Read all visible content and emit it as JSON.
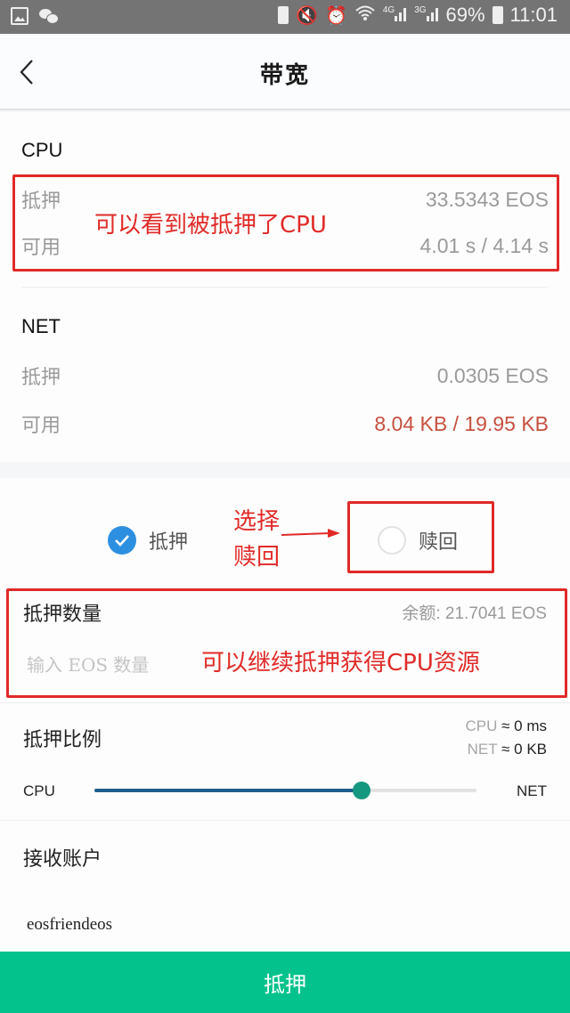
{
  "status_bar": {
    "left_icons": [
      "gallery-icon",
      "wechat-icon"
    ],
    "right_icons": [
      "battery-saver-icon",
      "mute-icon",
      "alarm-icon",
      "wifi-icon",
      "signal-4g-icon",
      "signal-3g-icon"
    ],
    "network_4g": "4G",
    "network_3g": "3G",
    "battery_percent": "69%",
    "time": "11:01"
  },
  "header": {
    "back_icon": "chevron-left-icon",
    "title": "带宽"
  },
  "cpu": {
    "title": "CPU",
    "staked_label": "抵押",
    "staked_value": "33.5343 EOS",
    "available_label": "可用",
    "available_value": "4.01 s / 4.14 s"
  },
  "net": {
    "title": "NET",
    "staked_label": "抵押",
    "staked_value": "0.0305 EOS",
    "available_label": "可用",
    "available_value": "8.04 KB / 19.95 KB",
    "available_color": "#c6503f"
  },
  "mode": {
    "options": [
      {
        "label": "抵押",
        "checked": true
      },
      {
        "label": "赎回",
        "checked": false
      }
    ]
  },
  "stake_amount": {
    "label": "抵押数量",
    "balance": "余额: 21.7041 EOS",
    "placeholder": "输入 EOS 数量",
    "value": ""
  },
  "ratio": {
    "label": "抵押比例",
    "cpu_key": "CPU",
    "cpu_est": " ≈ 0 ms",
    "net_key": "NET",
    "net_est": " ≈ 0 KB",
    "left_label": "CPU",
    "right_label": "NET",
    "slider_fraction": 0.7,
    "fill_color": "#1f5f8b",
    "thumb_color": "#15977f"
  },
  "receiver": {
    "label": "接收账户",
    "value": "eosfriendeos"
  },
  "submit": {
    "label": "抵押",
    "color": "#04c28c"
  },
  "annotations": {
    "cpu_note": "可以看到被抵押了CPU",
    "redeem_note_line1": "选择",
    "redeem_note_line2": "赎回",
    "stake_note": "可以继续抵押获得CPU资源",
    "color": "#e02a28"
  }
}
